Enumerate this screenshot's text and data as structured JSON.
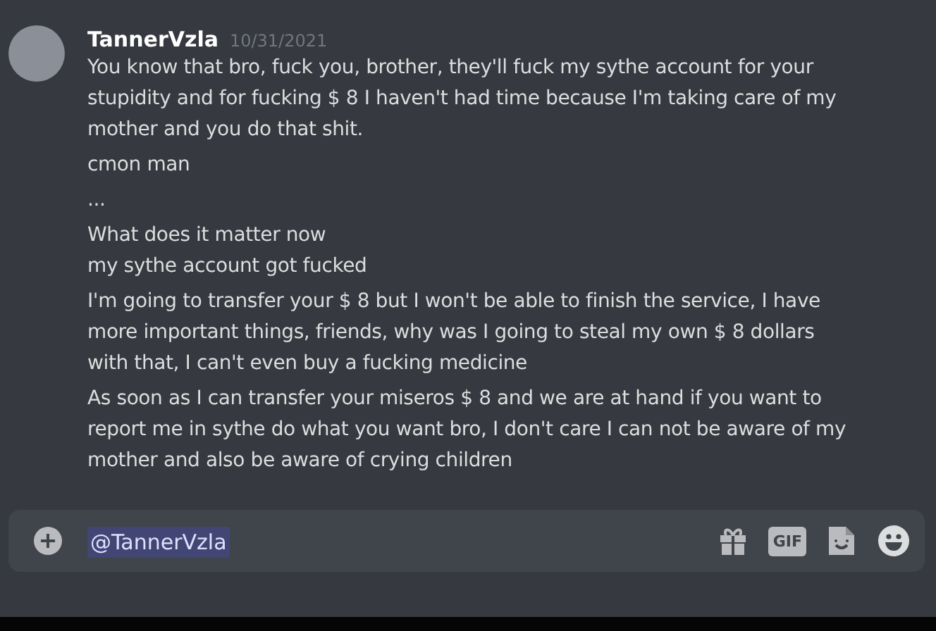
{
  "message_group": {
    "author": "TannerVzla",
    "timestamp": "10/31/2021",
    "messages": [
      "You know that bro, fuck you, brother, they'll fuck my sythe account for your stupidity and for fucking $ 8 I haven't had time because I'm taking care of my mother and you do that shit.",
      "cmon man",
      "...",
      "What does it matter now\nmy sythe account got fucked",
      "I'm going to transfer your $ 8 but I won't be able to finish the service, I have more important things, friends, why was I going to steal my own $ 8 dollars with that, I can't even buy a fucking medicine",
      "As soon as I can transfer your miseros $ 8 and we are at hand if you want to report me in sythe do what you want bro, I don't care I can not be aware of my mother and also be aware of crying children"
    ]
  },
  "composer": {
    "value": "@TannerVzla",
    "buttons": [
      {
        "kind": "gift"
      },
      {
        "kind": "gif",
        "label": "GIF"
      },
      {
        "kind": "sticker"
      },
      {
        "kind": "emoji"
      }
    ]
  }
}
